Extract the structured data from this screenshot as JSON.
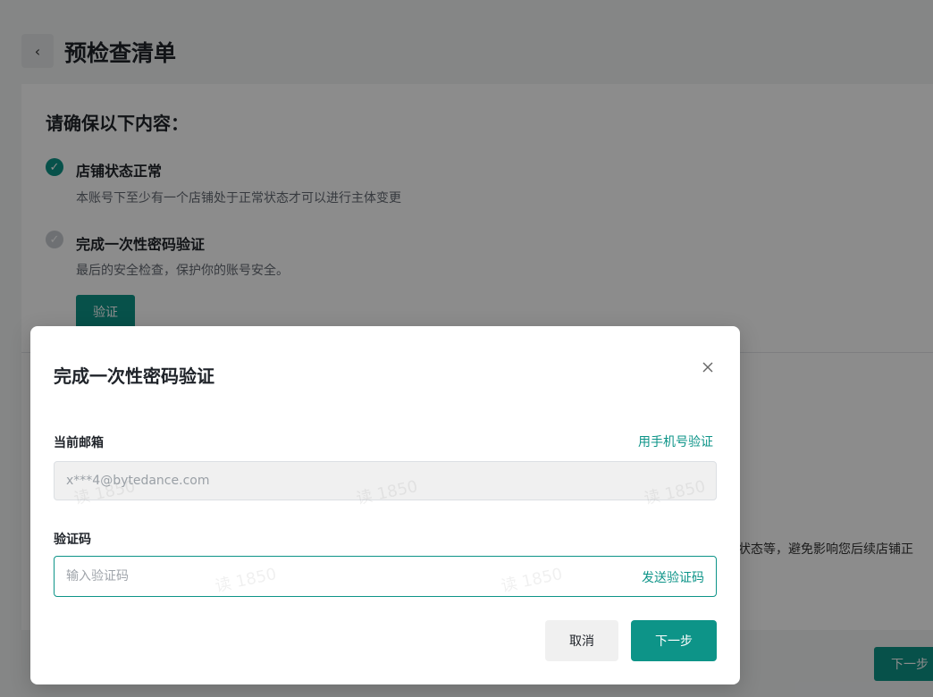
{
  "page": {
    "back_icon": "chevron-left-icon",
    "title": "预检查清单",
    "section_heading": "请确保以下内容：",
    "checklist": [
      {
        "title": "店铺状态正常",
        "desc": "本账号下至少有一个店铺处于正常状态才可以进行主体变更",
        "status": "done"
      },
      {
        "title": "完成一次性密码验证",
        "desc": "最后的安全检查，保护你的账号安全。",
        "status": "pending"
      }
    ],
    "verify_button": "验证",
    "side_text": "状态等，避免影响您后续店铺正",
    "bottom_next": "下一步"
  },
  "modal": {
    "title": "完成一次性密码验证",
    "close_icon": "close-icon",
    "email_label": "当前邮箱",
    "switch_phone_link": "用手机号验证",
    "email_value": "x***4@bytedance.com",
    "code_label": "验证码",
    "code_placeholder": "输入验证码",
    "send_code_link": "发送验证码",
    "cancel_button": "取消",
    "next_button": "下一步",
    "watermark": "读 1850"
  },
  "colors": {
    "accent": "#0d9488",
    "overlay": "rgba(0,0,0,0.45)"
  }
}
